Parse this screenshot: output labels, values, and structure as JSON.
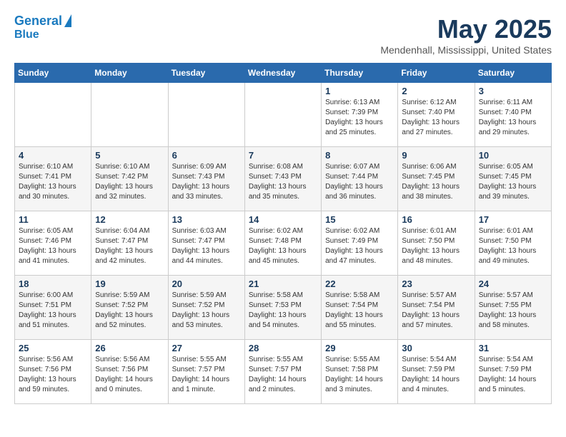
{
  "header": {
    "logo_line1": "General",
    "logo_line2": "Blue",
    "month": "May 2025",
    "location": "Mendenhall, Mississippi, United States"
  },
  "weekdays": [
    "Sunday",
    "Monday",
    "Tuesday",
    "Wednesday",
    "Thursday",
    "Friday",
    "Saturday"
  ],
  "weeks": [
    [
      {
        "day": "",
        "info": ""
      },
      {
        "day": "",
        "info": ""
      },
      {
        "day": "",
        "info": ""
      },
      {
        "day": "",
        "info": ""
      },
      {
        "day": "1",
        "info": "Sunrise: 6:13 AM\nSunset: 7:39 PM\nDaylight: 13 hours\nand 25 minutes."
      },
      {
        "day": "2",
        "info": "Sunrise: 6:12 AM\nSunset: 7:40 PM\nDaylight: 13 hours\nand 27 minutes."
      },
      {
        "day": "3",
        "info": "Sunrise: 6:11 AM\nSunset: 7:40 PM\nDaylight: 13 hours\nand 29 minutes."
      }
    ],
    [
      {
        "day": "4",
        "info": "Sunrise: 6:10 AM\nSunset: 7:41 PM\nDaylight: 13 hours\nand 30 minutes."
      },
      {
        "day": "5",
        "info": "Sunrise: 6:10 AM\nSunset: 7:42 PM\nDaylight: 13 hours\nand 32 minutes."
      },
      {
        "day": "6",
        "info": "Sunrise: 6:09 AM\nSunset: 7:43 PM\nDaylight: 13 hours\nand 33 minutes."
      },
      {
        "day": "7",
        "info": "Sunrise: 6:08 AM\nSunset: 7:43 PM\nDaylight: 13 hours\nand 35 minutes."
      },
      {
        "day": "8",
        "info": "Sunrise: 6:07 AM\nSunset: 7:44 PM\nDaylight: 13 hours\nand 36 minutes."
      },
      {
        "day": "9",
        "info": "Sunrise: 6:06 AM\nSunset: 7:45 PM\nDaylight: 13 hours\nand 38 minutes."
      },
      {
        "day": "10",
        "info": "Sunrise: 6:05 AM\nSunset: 7:45 PM\nDaylight: 13 hours\nand 39 minutes."
      }
    ],
    [
      {
        "day": "11",
        "info": "Sunrise: 6:05 AM\nSunset: 7:46 PM\nDaylight: 13 hours\nand 41 minutes."
      },
      {
        "day": "12",
        "info": "Sunrise: 6:04 AM\nSunset: 7:47 PM\nDaylight: 13 hours\nand 42 minutes."
      },
      {
        "day": "13",
        "info": "Sunrise: 6:03 AM\nSunset: 7:47 PM\nDaylight: 13 hours\nand 44 minutes."
      },
      {
        "day": "14",
        "info": "Sunrise: 6:02 AM\nSunset: 7:48 PM\nDaylight: 13 hours\nand 45 minutes."
      },
      {
        "day": "15",
        "info": "Sunrise: 6:02 AM\nSunset: 7:49 PM\nDaylight: 13 hours\nand 47 minutes."
      },
      {
        "day": "16",
        "info": "Sunrise: 6:01 AM\nSunset: 7:50 PM\nDaylight: 13 hours\nand 48 minutes."
      },
      {
        "day": "17",
        "info": "Sunrise: 6:01 AM\nSunset: 7:50 PM\nDaylight: 13 hours\nand 49 minutes."
      }
    ],
    [
      {
        "day": "18",
        "info": "Sunrise: 6:00 AM\nSunset: 7:51 PM\nDaylight: 13 hours\nand 51 minutes."
      },
      {
        "day": "19",
        "info": "Sunrise: 5:59 AM\nSunset: 7:52 PM\nDaylight: 13 hours\nand 52 minutes."
      },
      {
        "day": "20",
        "info": "Sunrise: 5:59 AM\nSunset: 7:52 PM\nDaylight: 13 hours\nand 53 minutes."
      },
      {
        "day": "21",
        "info": "Sunrise: 5:58 AM\nSunset: 7:53 PM\nDaylight: 13 hours\nand 54 minutes."
      },
      {
        "day": "22",
        "info": "Sunrise: 5:58 AM\nSunset: 7:54 PM\nDaylight: 13 hours\nand 55 minutes."
      },
      {
        "day": "23",
        "info": "Sunrise: 5:57 AM\nSunset: 7:54 PM\nDaylight: 13 hours\nand 57 minutes."
      },
      {
        "day": "24",
        "info": "Sunrise: 5:57 AM\nSunset: 7:55 PM\nDaylight: 13 hours\nand 58 minutes."
      }
    ],
    [
      {
        "day": "25",
        "info": "Sunrise: 5:56 AM\nSunset: 7:56 PM\nDaylight: 13 hours\nand 59 minutes."
      },
      {
        "day": "26",
        "info": "Sunrise: 5:56 AM\nSunset: 7:56 PM\nDaylight: 14 hours\nand 0 minutes."
      },
      {
        "day": "27",
        "info": "Sunrise: 5:55 AM\nSunset: 7:57 PM\nDaylight: 14 hours\nand 1 minute."
      },
      {
        "day": "28",
        "info": "Sunrise: 5:55 AM\nSunset: 7:57 PM\nDaylight: 14 hours\nand 2 minutes."
      },
      {
        "day": "29",
        "info": "Sunrise: 5:55 AM\nSunset: 7:58 PM\nDaylight: 14 hours\nand 3 minutes."
      },
      {
        "day": "30",
        "info": "Sunrise: 5:54 AM\nSunset: 7:59 PM\nDaylight: 14 hours\nand 4 minutes."
      },
      {
        "day": "31",
        "info": "Sunrise: 5:54 AM\nSunset: 7:59 PM\nDaylight: 14 hours\nand 5 minutes."
      }
    ]
  ]
}
